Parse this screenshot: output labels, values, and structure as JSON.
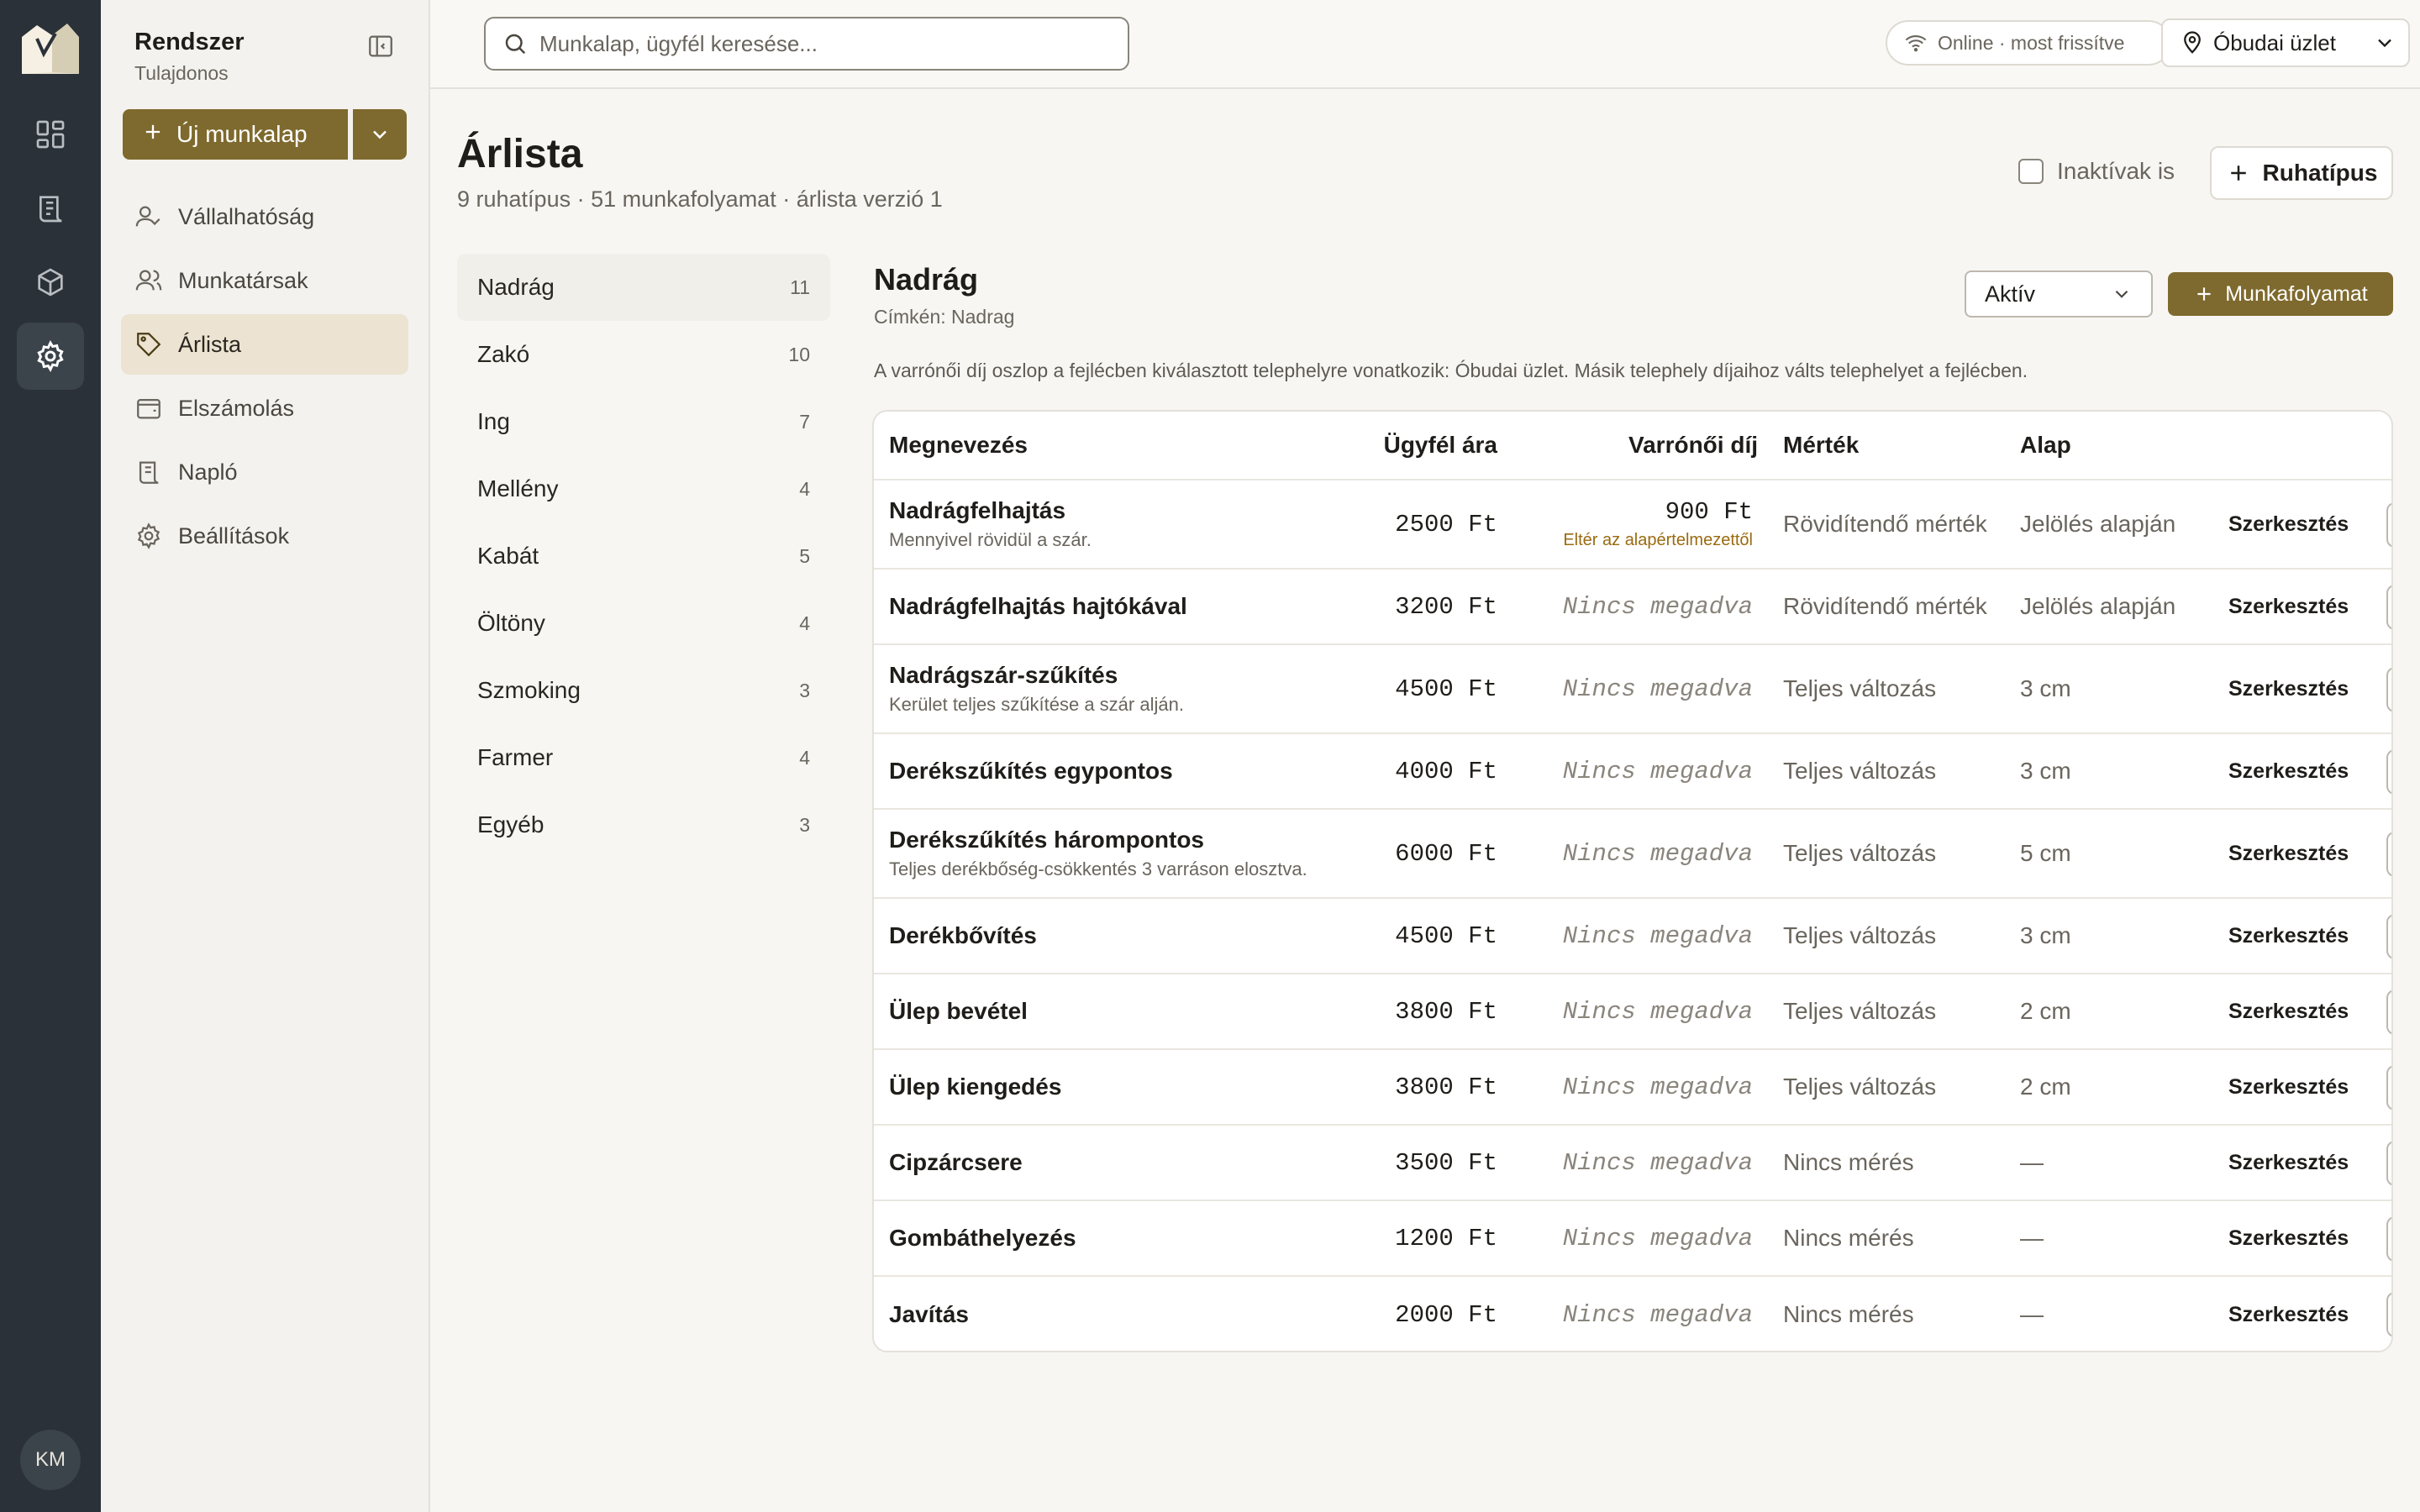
{
  "sidebar": {
    "title": "Rendszer",
    "role": "Tulajdonos",
    "new_button": "Új munkalap",
    "items": [
      {
        "label": "Vállalhatóság",
        "icon": "user-check-icon"
      },
      {
        "label": "Munkatársak",
        "icon": "users-icon"
      },
      {
        "label": "Árlista",
        "icon": "tag-icon",
        "active": true
      },
      {
        "label": "Elszámolás",
        "icon": "wallet-icon"
      },
      {
        "label": "Napló",
        "icon": "scroll-icon"
      },
      {
        "label": "Beállítások",
        "icon": "gear-icon"
      }
    ]
  },
  "rail": {
    "avatar_initials": "KM"
  },
  "topbar": {
    "search_placeholder": "Munkalap, ügyfél keresése...",
    "status": "Online · most frissítve",
    "store": "Óbudai üzlet"
  },
  "page": {
    "title": "Árlista",
    "subtitle": "9 ruhatípus · 51 munkafolyamat · árlista verzió 1",
    "inactive_label": "Inaktívak is",
    "add_type_button": "Ruhatípus"
  },
  "categories": [
    {
      "name": "Nadrág",
      "count": "11",
      "active": true
    },
    {
      "name": "Zakó",
      "count": "10"
    },
    {
      "name": "Ing",
      "count": "7"
    },
    {
      "name": "Mellény",
      "count": "4"
    },
    {
      "name": "Kabát",
      "count": "5"
    },
    {
      "name": "Öltöny",
      "count": "4"
    },
    {
      "name": "Szmoking",
      "count": "3"
    },
    {
      "name": "Farmer",
      "count": "4"
    },
    {
      "name": "Egyéb",
      "count": "3"
    }
  ],
  "detail": {
    "title": "Nadrág",
    "label_line": "Címkén: Nadrag",
    "status_select": "Aktív",
    "add_workflow_button": "Munkafolyamat",
    "note": "A varrónői díj oszlop a fejlécben kiválasztott telephelyre vonatkozik: Óbudai üzlet. Másik telephely díjaihoz válts telephelyet a fejlécben."
  },
  "table": {
    "headers": {
      "name": "Megnevezés",
      "price": "Ügyfél ára",
      "fee": "Varrónői díj",
      "measure": "Mérték",
      "base": "Alap"
    },
    "edit_label": "Szerkesztés",
    "rows": [
      {
        "name": "Nadrágfelhajtás",
        "desc": "Mennyivel rövidül a szár.",
        "price": "2500 Ft",
        "fee": "900 Ft",
        "fee_note": "Eltér az alapértelmezettől",
        "measure": "Rövidítendő mérték",
        "base": "Jelölés alapján"
      },
      {
        "name": "Nadrágfelhajtás hajtókával",
        "desc": "",
        "price": "3200 Ft",
        "fee": "Nincs megadva",
        "fee_note": "",
        "measure": "Rövidítendő mérték",
        "base": "Jelölés alapján"
      },
      {
        "name": "Nadrágszár-szűkítés",
        "desc": "Kerület teljes szűkítése a szár alján.",
        "price": "4500 Ft",
        "fee": "Nincs megadva",
        "fee_note": "",
        "measure": "Teljes változás",
        "base": "3 cm"
      },
      {
        "name": "Derékszűkítés egypontos",
        "desc": "",
        "price": "4000 Ft",
        "fee": "Nincs megadva",
        "fee_note": "",
        "measure": "Teljes változás",
        "base": "3 cm"
      },
      {
        "name": "Derékszűkítés hárompontos",
        "desc": "Teljes derékbőség-csökkentés 3 varráson elosztva.",
        "price": "6000 Ft",
        "fee": "Nincs megadva",
        "fee_note": "",
        "measure": "Teljes változás",
        "base": "5 cm"
      },
      {
        "name": "Derékbővítés",
        "desc": "",
        "price": "4500 Ft",
        "fee": "Nincs megadva",
        "fee_note": "",
        "measure": "Teljes változás",
        "base": "3 cm"
      },
      {
        "name": "Ülep bevétel",
        "desc": "",
        "price": "3800 Ft",
        "fee": "Nincs megadva",
        "fee_note": "",
        "measure": "Teljes változás",
        "base": "2 cm"
      },
      {
        "name": "Ülep kiengedés",
        "desc": "",
        "price": "3800 Ft",
        "fee": "Nincs megadva",
        "fee_note": "",
        "measure": "Teljes változás",
        "base": "2 cm"
      },
      {
        "name": "Cipzárcsere",
        "desc": "",
        "price": "3500 Ft",
        "fee": "Nincs megadva",
        "fee_note": "",
        "measure": "Nincs mérés",
        "base": "—"
      },
      {
        "name": "Gombáthelyezés",
        "desc": "",
        "price": "1200 Ft",
        "fee": "Nincs megadva",
        "fee_note": "",
        "measure": "Nincs mérés",
        "base": "—"
      },
      {
        "name": "Javítás",
        "desc": "",
        "price": "2000 Ft",
        "fee": "Nincs megadva",
        "fee_note": "",
        "measure": "Nincs mérés",
        "base": "—"
      }
    ]
  },
  "colors": {
    "accent": "#7e6a2e",
    "rail": "#2a3138",
    "active_nav": "#ece3d2",
    "warning_text": "#9a6a10"
  }
}
